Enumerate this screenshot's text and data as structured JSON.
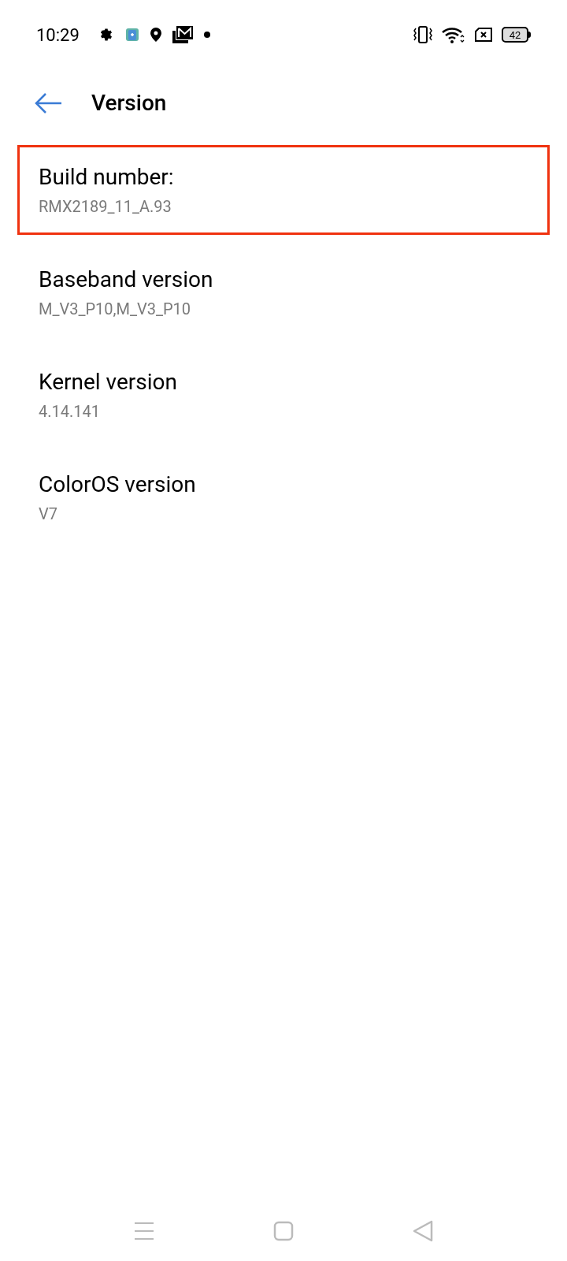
{
  "status_bar": {
    "time": "10:29",
    "battery": "42"
  },
  "header": {
    "title": "Version"
  },
  "items": [
    {
      "title": "Build number:",
      "value": "RMX2189_11_A.93",
      "highlighted": true
    },
    {
      "title": "Baseband version",
      "value": "M_V3_P10,M_V3_P10",
      "highlighted": false
    },
    {
      "title": "Kernel version",
      "value": "4.14.141",
      "highlighted": false
    },
    {
      "title": "ColorOS version",
      "value": "V7",
      "highlighted": false
    }
  ]
}
